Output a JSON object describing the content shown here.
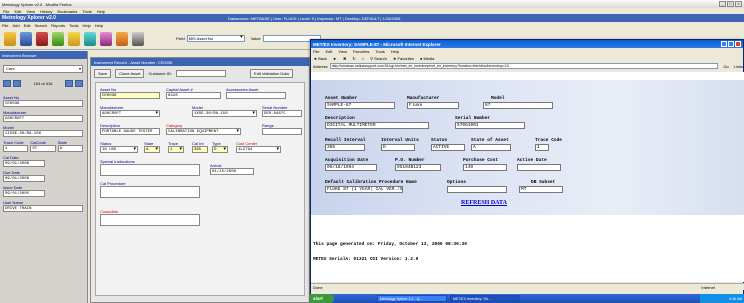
{
  "firefox": {
    "title": "Metrology Xplorer v2.0 - Mozilla Firefox",
    "menu": [
      "File",
      "Edit",
      "View",
      "History",
      "Bookmarks",
      "Tools",
      "Help"
    ]
  },
  "app": {
    "title": "Metrology Xplorer v2.0",
    "info": "Datasource: METBASE  |  User: FLUKE  |  Level: 5  |  Inspector: MT  |  Desktop: DEFAULT  |  1/15/2008",
    "menu": [
      "File",
      "Add",
      "Edit",
      "Search",
      "Reports",
      "Tools",
      "Help",
      "Help"
    ],
    "field_label": "Field",
    "field_value": "MIS Asset No",
    "value_label": "Value"
  },
  "browser": {
    "title": "Instrument Browser",
    "combo": "Cars",
    "nav_count": "154 of 416",
    "fields": {
      "asset_no_label": "Asset No",
      "asset_no": "CE0036",
      "manufacturer_label": "Manufacturer",
      "manufacturer": "ASHCROFT",
      "model_label": "Model",
      "model": "1IXSE-30/RA-150",
      "trace_code_label": "Trace Code",
      "cal_code_label": "CalCode",
      "status_label": "State",
      "trace_code": "1",
      "cal_code": "ST",
      "status_val": "A",
      "cal_date_label": "Cal Date",
      "cal_date": "09/01/2008",
      "due_date_label": "Due Date",
      "due_date": "09/01/2008",
      "issue_date_label": "Issue Date",
      "issue_date": "09/01/2005",
      "user_name_label": "User Name",
      "user_name": "DRIVE TRAIN"
    }
  },
  "record": {
    "title": "Instrument Record - Asset Number: CE0036",
    "save": "Save",
    "clone": "Clone Asset",
    "customer_id_label": "Customer ID:",
    "edit_validation": "Edit Validation Data",
    "asset_no_label": "Asset No",
    "asset_no": "CE0036",
    "capital_asset_label": "Capital Asset #",
    "capital_asset": "8428",
    "accessories_label": "Accessories Asset",
    "manufacturer_label": "Manufacturer",
    "manufacturer": "ASHCROFT",
    "model_label": "Model",
    "model": "1XSE-30/RA-150",
    "serial_label": "Serial Number",
    "serial": "DER-0467C",
    "description_label": "Description",
    "description": "PORTABLE GAUGE TESTER",
    "category_label": "Category",
    "category": "CALIBRATION EQUIPMENT",
    "range_label": "Range",
    "status_label": "Status",
    "status": "IN USE",
    "state_label": "State",
    "state": "A",
    "trace_label": "Trace Code",
    "trace": "1",
    "calint_label": "Cal Int",
    "calint": "365",
    "type_label": "Type",
    "type": "D",
    "costcenter_label": "Cost Center",
    "costcenter": "4L2794",
    "special_label": "Special Instructions",
    "arrival_label": "Arrival",
    "arrival": "01/15/2008",
    "calproc_label": "Cal Procedure",
    "custodian_label": "Custodian"
  },
  "ie": {
    "title": "MET/EX Inventory: SAMPLE-87 - Microsoft Internet Explorer",
    "menu": [
      "File",
      "Edit",
      "View",
      "Favorites",
      "Tools",
      "Help"
    ],
    "toolbar": [
      "Back",
      "Search",
      "Favorites",
      "Media"
    ],
    "address_label": "Address",
    "address": "http://windows.ontinasupport.com:51/cgi-bin/met_ex_inventory/met_ex_inventory?function=fetchtinv&inventory=10",
    "go": "Go",
    "links": "Links",
    "status": "Done",
    "zone": "Internet"
  },
  "form": {
    "asset_label": "Asset Number",
    "asset": "SAMPLE-87",
    "mfr_label": "Manufacturer",
    "mfr": "Fluke",
    "model_label": "Model",
    "model": "87",
    "desc_label": "Description",
    "desc": "DIGITAL MULTIMETER",
    "serial_label": "Serial Number",
    "serial": "67061001",
    "recall_label": "Recall Interval",
    "recall": "365",
    "units_label": "Interval Units",
    "units": "D",
    "status_label": "Status",
    "status": "ACTIVE",
    "state_label": "State of Asset",
    "state": "A",
    "trace_label": "Trace Code",
    "trace": "1",
    "acq_label": "Acquisition Date",
    "acq": "06/16/1994",
    "po_label": "P.O. Number",
    "po": "95104B123",
    "cost_label": "Purchase Cost",
    "cost": "149",
    "active_label": "Active Date",
    "active": "",
    "proc_label": "Default Calibration Procedure Name",
    "proc": "FLUKE 87 (1 YEAR) CAL VER./5",
    "options_label": "Options",
    "options": "",
    "subset_label": "DB Subset",
    "subset": "MT",
    "refresh": "REFRESH DATA",
    "generated": "This page generated on: Friday, October 13, 2006 08:36:30",
    "serial_line": "METEX  SerialA: 01321  CGI Version: 1.2.0"
  },
  "taskbar": {
    "start": "start",
    "tasks": [
      "Metrology Xplorer 1.2 - Q...",
      "MET/EX Inventory: SA..."
    ],
    "clock": "9:36 AM"
  }
}
